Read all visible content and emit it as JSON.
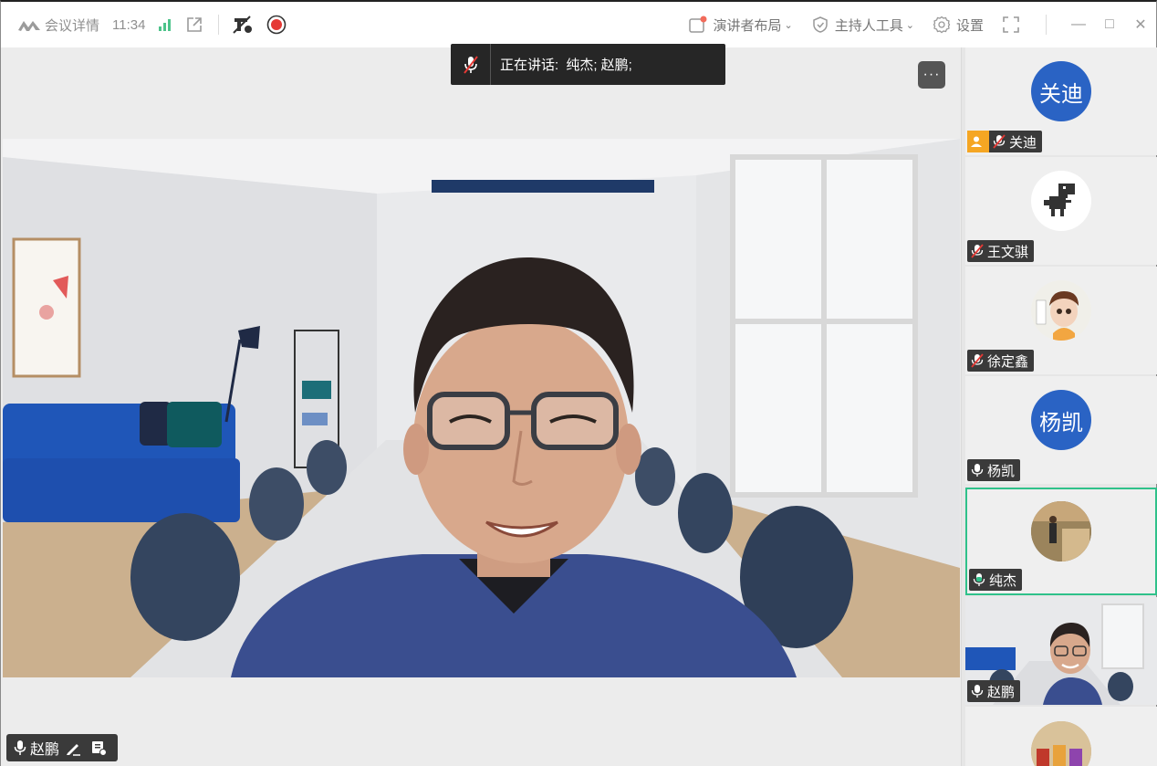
{
  "topbar": {
    "meeting_details": "会议详情",
    "time": "11:34",
    "presenter_layout": "演讲者布局",
    "host_tools": "主持人工具",
    "settings": "设置"
  },
  "stage": {
    "speaking_label": "正在讲话:",
    "speaking_names": "纯杰; 赵鹏;",
    "more_label": "···",
    "main_speaker": "赵鹏"
  },
  "participants": [
    {
      "name": "关迪",
      "avatar_text": "关迪",
      "mic": "muted",
      "host": true
    },
    {
      "name": "王文骐",
      "avatar_text": "",
      "mic": "muted",
      "host": false
    },
    {
      "name": "徐定鑫",
      "avatar_text": "",
      "mic": "muted",
      "host": false
    },
    {
      "name": "杨凯",
      "avatar_text": "杨凯",
      "mic": "on",
      "host": false
    },
    {
      "name": "纯杰",
      "avatar_text": "",
      "mic": "speaking",
      "host": false
    },
    {
      "name": "赵鹏",
      "avatar_text": "",
      "mic": "on",
      "host": false
    }
  ],
  "colors": {
    "avatar_blue": "#2a63c4",
    "active_border": "#2fc18a",
    "record_red": "#e53935",
    "host_badge": "#f5a623"
  }
}
